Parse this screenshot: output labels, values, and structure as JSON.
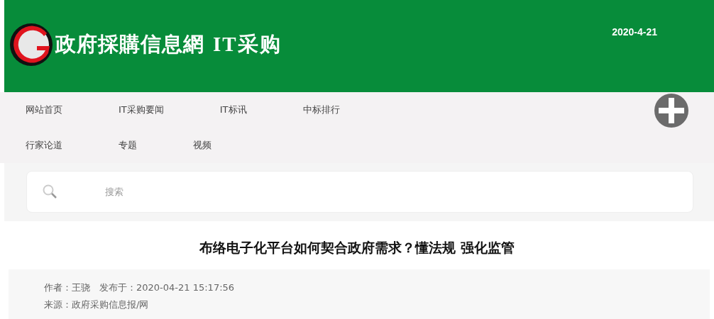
{
  "header": {
    "site_name": "政府採購信息網",
    "section": "IT采购",
    "date": "2020-4-21"
  },
  "nav": {
    "rows": [
      [
        "网站首页",
        "IT采购要闻",
        "IT标讯",
        "中标排行"
      ],
      [
        "行家论道",
        "专题",
        "视频"
      ]
    ]
  },
  "search": {
    "placeholder": "搜索"
  },
  "article": {
    "title": "布络电子化平台如何契合政府需求？懂法规 强化监管",
    "meta": [
      "作者：王骁　发布于：2020-04-21 15:17:56",
      "来源：政府采购信息报/网"
    ]
  }
}
